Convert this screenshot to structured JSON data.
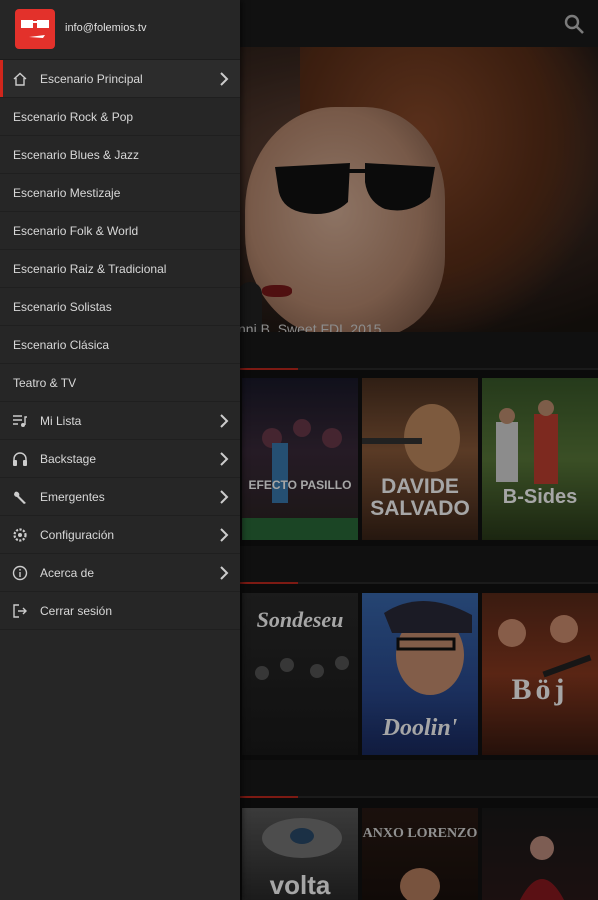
{
  "header": {
    "email": "info@folemios.tv"
  },
  "hero": {
    "caption": "nni B. Sweet FDL 2015"
  },
  "menu": [
    {
      "label": "Escenario Principal",
      "icon": "home-icon",
      "chevron": true,
      "active": true
    },
    {
      "label": "Escenario Rock & Pop"
    },
    {
      "label": "Escenario Blues & Jazz"
    },
    {
      "label": "Escenario Mestizaje"
    },
    {
      "label": "Escenario Folk & World"
    },
    {
      "label": "Escenario Raiz & Tradicional"
    },
    {
      "label": "Escenario Solistas"
    },
    {
      "label": "Escenario Clásica"
    },
    {
      "label": "Teatro & TV"
    },
    {
      "label": "Mi Lista",
      "icon": "playlist-icon",
      "chevron": true
    },
    {
      "label": "Backstage",
      "icon": "headphones-icon",
      "chevron": true
    },
    {
      "label": "Emergentes",
      "icon": "wrench-icon",
      "chevron": true
    },
    {
      "label": "Configuración",
      "icon": "settings-icon",
      "chevron": true
    },
    {
      "label": "Acerca de",
      "icon": "info-icon",
      "chevron": true
    },
    {
      "label": "Cerrar sesión",
      "icon": "logout-icon"
    }
  ],
  "cards": {
    "row1": [
      "EFECTO PASILLO",
      "DAVIDE SALVADO",
      "B-Sides"
    ],
    "row2": [
      "Sondeseu",
      "Doolin'",
      "Böj"
    ],
    "row3": [
      "volta",
      "ANXO LORENZO",
      ""
    ]
  },
  "colors": {
    "accent": "#d0261c",
    "drawer": "#262626",
    "background": "#121212"
  }
}
